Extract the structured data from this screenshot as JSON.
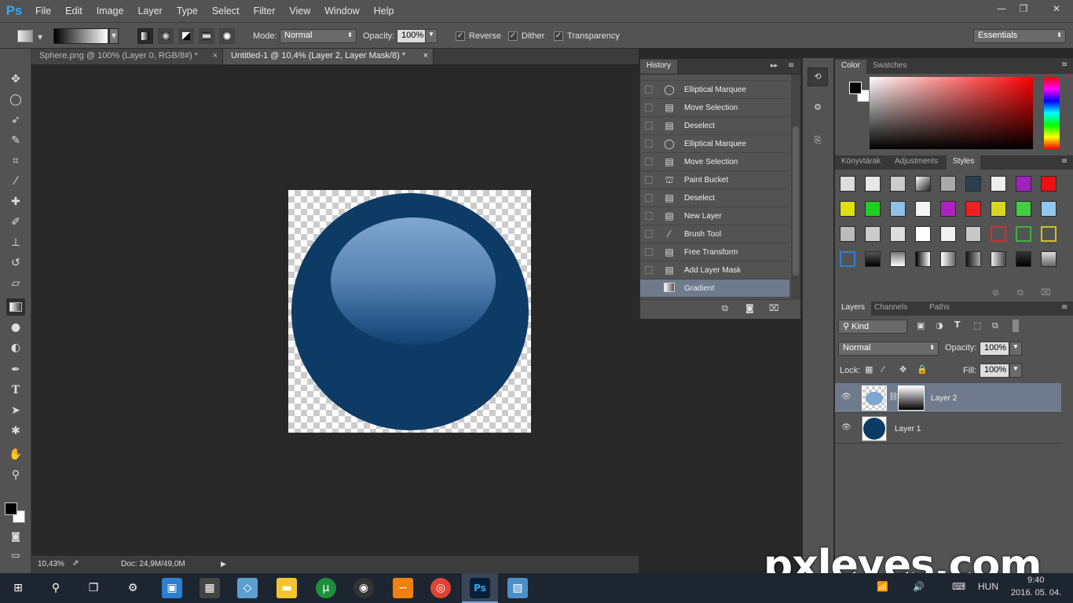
{
  "menubar": {
    "logo": "Ps",
    "items": [
      "File",
      "Edit",
      "Image",
      "Layer",
      "Type",
      "Select",
      "Filter",
      "View",
      "Window",
      "Help"
    ],
    "window_controls": [
      "—",
      "❐",
      "✕"
    ]
  },
  "options": {
    "mode_label": "Mode:",
    "mode_value": "Normal",
    "opacity_label": "Opacity:",
    "opacity_value": "100%",
    "reverse_label": "Reverse",
    "dither_label": "Dither",
    "transparency_label": "Transparency",
    "workspace": "Essentials"
  },
  "tabs": [
    {
      "label": "Sphere.png @ 100% (Layer 0, RGB/8#) *"
    },
    {
      "label": "Untitled-1 @ 10,4% (Layer 2, Layer Mask/8) *"
    }
  ],
  "status": {
    "zoom": "10,43%",
    "doc": "Doc: 24,9M/49,0M"
  },
  "history": {
    "title": "History",
    "items": [
      {
        "label": "Elliptical Marquee",
        "icon": "ellipse-icon"
      },
      {
        "label": "Move Selection",
        "icon": "doc-icon"
      },
      {
        "label": "Deselect",
        "icon": "doc-icon"
      },
      {
        "label": "Elliptical Marquee",
        "icon": "ellipse-icon"
      },
      {
        "label": "Move Selection",
        "icon": "doc-icon"
      },
      {
        "label": "Paint Bucket",
        "icon": "bucket-icon"
      },
      {
        "label": "Deselect",
        "icon": "doc-icon"
      },
      {
        "label": "New Layer",
        "icon": "doc-icon"
      },
      {
        "label": "Brush Tool",
        "icon": "brush-icon"
      },
      {
        "label": "Free Transform",
        "icon": "doc-icon"
      },
      {
        "label": "Add Layer Mask",
        "icon": "doc-icon"
      },
      {
        "label": "Gradient",
        "icon": "gradient-icon"
      }
    ]
  },
  "color_panel": {
    "tabs": [
      "Color",
      "Swatches"
    ]
  },
  "styles_panel": {
    "tabs": [
      "Könyvtárak",
      "Adjustments",
      "Styles"
    ]
  },
  "layers_panel": {
    "tabs": [
      "Layers",
      "Channels",
      "Paths"
    ],
    "kind": "Kind",
    "blend": "Normal",
    "opacity_label": "Opacity:",
    "opacity": "100%",
    "lock_label": "Lock:",
    "fill_label": "Fill:",
    "fill": "100%",
    "layers": [
      {
        "name": "Layer 2"
      },
      {
        "name": "Layer 1"
      }
    ]
  },
  "taskbar": {
    "lang": "HUN",
    "time": "9:40",
    "date": "2016. 05. 04."
  },
  "watermark": "pxleyes.com",
  "colors": {
    "sphere": "#0d3b66",
    "highlight_top": "#7fa7cf",
    "selected_row": "#6f7b8c"
  }
}
